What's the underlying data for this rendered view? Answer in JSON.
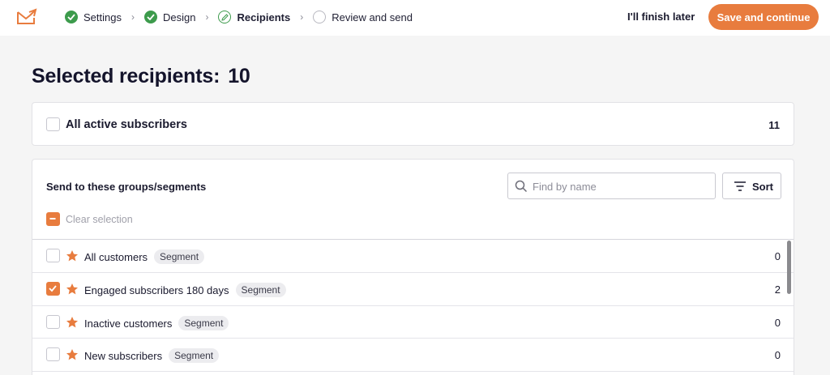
{
  "steps": [
    {
      "label": "Settings",
      "state": "done"
    },
    {
      "label": "Design",
      "state": "done"
    },
    {
      "label": "Recipients",
      "state": "current"
    },
    {
      "label": "Review and send",
      "state": "todo"
    }
  ],
  "header": {
    "finish_later": "I'll finish later",
    "save_continue": "Save and continue"
  },
  "page": {
    "title": "Selected recipients:",
    "count": "10"
  },
  "all_active": {
    "label": "All active subscribers",
    "count": "11",
    "checked": false
  },
  "groups": {
    "title": "Send to these groups/segments",
    "search_placeholder": "Find by name",
    "sort_label": "Sort",
    "clear_selection": "Clear selection",
    "items": [
      {
        "name": "All customers",
        "badge": "Segment",
        "count": "0",
        "checked": false
      },
      {
        "name": "Engaged subscribers 180 days",
        "badge": "Segment",
        "count": "2",
        "checked": true
      },
      {
        "name": "Inactive customers",
        "badge": "Segment",
        "count": "0",
        "checked": false
      },
      {
        "name": "New subscribers",
        "badge": "Segment",
        "count": "0",
        "checked": false
      }
    ]
  },
  "colors": {
    "accent": "#e87c3e",
    "success": "#3d9b4c",
    "text": "#1a1a2e",
    "background": "#f5f5f5"
  },
  "icons": {
    "logo": "envelope-arrow-icon",
    "done_step": "check-circle-icon",
    "current_step": "pencil-circle-icon",
    "todo_step": "empty-circle-icon",
    "step_separator": "chevron-right-icon",
    "search": "search-icon",
    "sort": "filter-lines-icon",
    "favorite": "star-icon"
  }
}
